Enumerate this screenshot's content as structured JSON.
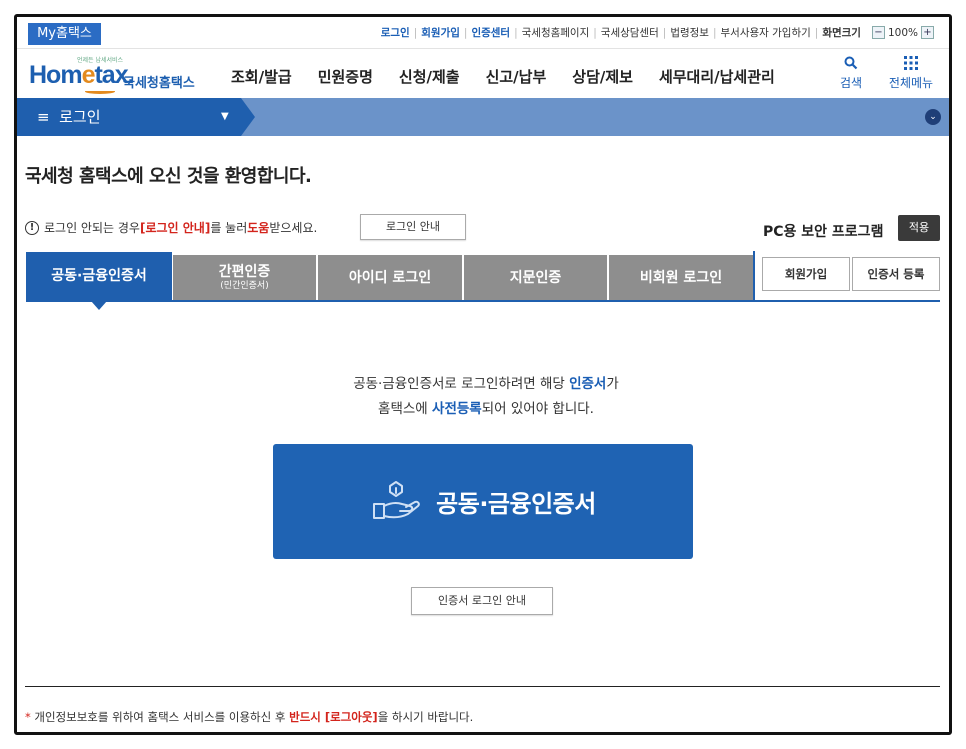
{
  "util": {
    "my_hometax": "My홈택스",
    "links": {
      "login": "로그인",
      "join": "회원가입",
      "cert_center": "인증센터",
      "nts_home": "국세청홈페이지",
      "consult": "국세상담센터",
      "law": "법령정보",
      "dept_join": "부서사용자 가입하기",
      "font_size": "화면크기"
    },
    "zoom_minus": "−",
    "zoom_value": "100%",
    "zoom_plus": "+"
  },
  "header": {
    "logo_small": "언제든 납세서비스",
    "logo_home": "Hom",
    "logo_e": "e",
    "logo_tax": "tax.",
    "logo_kr": "국세청홈택스",
    "nav": [
      "조회/발급",
      "민원증명",
      "신청/제출",
      "신고/납부",
      "상담/제보",
      "세무대리/납세관리"
    ],
    "search_label": "검색",
    "menu_label": "전체메뉴",
    "search_glyph": "🔍",
    "menu_glyph": "⁝⁝⁝"
  },
  "breadcrumb": {
    "menu_glyph": "≡",
    "label": "로그인",
    "caret": "▼",
    "circle": "⌄"
  },
  "welcome": "국세청 홈택스에 오신 것을 환영합니다.",
  "notice": {
    "icon": "!",
    "part1": "로그인 안되는 경우 ",
    "link": "[로그인 안내]",
    "part2": "를 눌러 ",
    "help": "도움",
    "part3": "받으세요.",
    "button": "로그인 안내"
  },
  "security": {
    "label": "PC용 보안 프로그램",
    "apply": "적용"
  },
  "tabs": [
    {
      "label": "공동·금융인증서",
      "sub": ""
    },
    {
      "label": "간편인증",
      "sub": "(민간인증서)"
    },
    {
      "label": "아이디 로그인",
      "sub": ""
    },
    {
      "label": "지문인증",
      "sub": ""
    },
    {
      "label": "비회원 로그인",
      "sub": ""
    }
  ],
  "right_buttons": {
    "join": "회원가입",
    "register": "인증서 등록"
  },
  "message": {
    "line1_a": "공동·금융인증서로 로그인하려면 해당 ",
    "line1_b": "인증서",
    "line1_c": "가",
    "line2_a": "홈택스에 ",
    "line2_b": "사전등록",
    "line2_c": "되어 있어야 합니다."
  },
  "big_button": "공동·금융인증서",
  "guide_button": "인증서 로그인 안내",
  "footer": {
    "dot": "*",
    "a": " 개인정보보호를 위하여 홈택스 서비스를 이용하신 후 ",
    "b": "반드시 [로그아웃]",
    "c": "을 하시기 바랍니다."
  },
  "colors": {
    "primary": "#1f5fae",
    "tab_inactive": "#8e8e8e",
    "accent_red": "#d3241c",
    "logo_orange": "#e38a1e"
  }
}
